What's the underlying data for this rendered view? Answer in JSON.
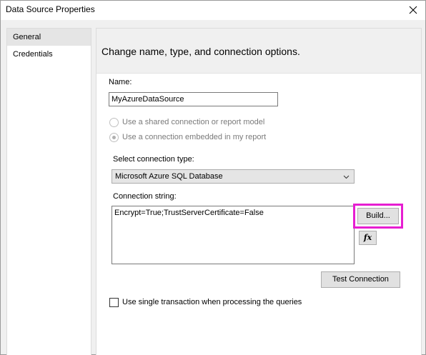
{
  "window": {
    "title": "Data Source Properties"
  },
  "nav": {
    "items": [
      {
        "label": "General",
        "selected": true
      },
      {
        "label": "Credentials",
        "selected": false
      }
    ]
  },
  "panel": {
    "heading": "Change name, type, and connection options.",
    "name_label": "Name:",
    "name_value": "MyAzureDataSource",
    "radio_shared": "Use a shared connection or report model",
    "radio_embedded": "Use a connection embedded in my report",
    "connection_type_label": "Select connection type:",
    "connection_type_value": "Microsoft Azure SQL Database",
    "connection_string_label": "Connection string:",
    "connection_string_value": "Encrypt=True;TrustServerCertificate=False",
    "build_button": "Build...",
    "fx_button": "fx",
    "test_connection_button": "Test Connection",
    "single_transaction_label": "Use single transaction when processing the queries"
  },
  "colors": {
    "highlight": "#e61ed1"
  }
}
